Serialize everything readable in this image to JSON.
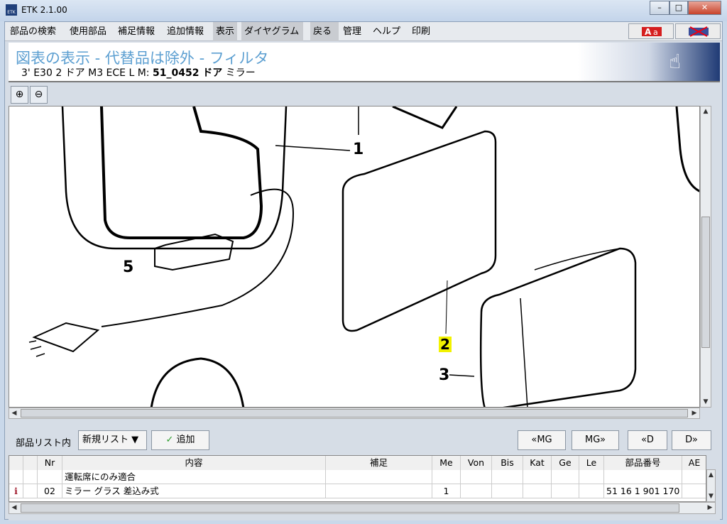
{
  "window": {
    "title": "ETK 2.1.00",
    "icon_text": "ETK"
  },
  "menu": [
    "部品の検索",
    "使用部品",
    "補足情報",
    "追加情報",
    "表示",
    "ダイヤグラム",
    "戻る",
    "管理",
    "ヘルプ",
    "印刷"
  ],
  "header": {
    "title": "図表の表示 - 代替品は除外 - フィルタ",
    "subtitle_prefix": "3' E30 2 ドア M3 ECE  L M: ",
    "subtitle_bold": "51_0452 ドア",
    "subtitle_suffix": " ミラー"
  },
  "diagram": {
    "callouts": [
      "1",
      "2",
      "3",
      "5"
    ],
    "highlighted_callout": "2"
  },
  "bottom": {
    "list_label": "部品リスト内",
    "list_select": "新規リスト",
    "add_label": "追加",
    "nav": [
      "«MG",
      "MG»",
      "«D",
      "D»"
    ]
  },
  "table": {
    "headers": [
      "",
      "",
      "Nr",
      "内容",
      "補足",
      "Me",
      "Von",
      "Bis",
      "Kat",
      "Ge",
      "Le",
      "部品番号",
      "AE"
    ],
    "rows": [
      [
        "",
        "",
        "",
        "運転席にのみ適合",
        "",
        "",
        "",
        "",
        "",
        "",
        "",
        "",
        ""
      ],
      [
        "i",
        "",
        "02",
        "ミラー グラス 差込み式",
        "",
        "1",
        "",
        "",
        "",
        "",
        "",
        "51 16 1 901 170",
        ""
      ]
    ]
  },
  "colors": {
    "title_blue": "#5c9fd1",
    "info_red": "#a0182a",
    "highlight_yellow": "#f2f200"
  }
}
